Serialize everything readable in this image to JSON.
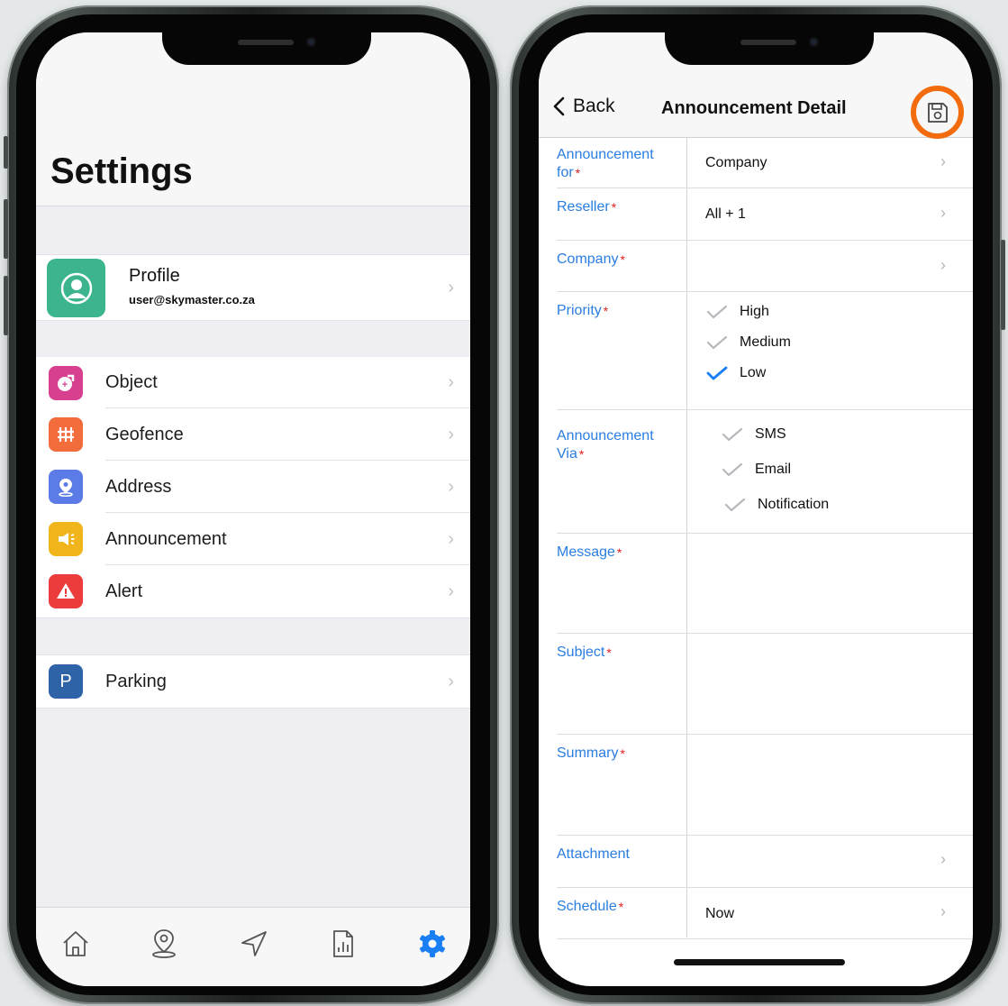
{
  "settings": {
    "title": "Settings",
    "profile": {
      "name": "Profile",
      "email": "user@skymaster.co.za"
    },
    "group1": [
      {
        "label": "Object",
        "icon": "object-icon",
        "color": "#d7408f"
      },
      {
        "label": "Geofence",
        "icon": "geofence-icon",
        "color": "#f26c3c"
      },
      {
        "label": "Address",
        "icon": "address-icon",
        "color": "#5b7be6"
      },
      {
        "label": "Announcement",
        "icon": "announcement-icon",
        "color": "#f1b51c"
      },
      {
        "label": "Alert",
        "icon": "alert-icon",
        "color": "#ec3c3c"
      }
    ],
    "group2": [
      {
        "label": "Parking",
        "icon": "parking-icon",
        "color": "#2e63a8",
        "glyph": "P"
      }
    ],
    "tabs": [
      "home-icon",
      "map-pin-icon",
      "navigation-icon",
      "report-icon",
      "settings-gear-icon"
    ],
    "active_tab_color": "#1a7ef5"
  },
  "detail": {
    "back_label": "Back",
    "title": "Announcement Detail",
    "save_icon": "save-icon",
    "fields": {
      "announcement_for": {
        "label": "Announcement for",
        "value": "Company"
      },
      "reseller": {
        "label": "Reseller",
        "value": "All + 1"
      },
      "company": {
        "label": "Company",
        "value": ""
      },
      "priority": {
        "label": "Priority",
        "options": [
          "High",
          "Medium",
          "Low"
        ],
        "selected": "Low"
      },
      "announcement_via": {
        "label": "Announcement Via",
        "options": [
          "SMS",
          "Email",
          "Notification"
        ]
      },
      "message": {
        "label": "Message"
      },
      "subject": {
        "label": "Subject"
      },
      "summary": {
        "label": "Summary"
      },
      "attachment": {
        "label": "Attachment"
      },
      "schedule": {
        "label": "Schedule",
        "value": "Now"
      }
    },
    "label_color": "#2a7de1",
    "required_color": "#e02020",
    "highlight_color": "#f26c0d"
  }
}
